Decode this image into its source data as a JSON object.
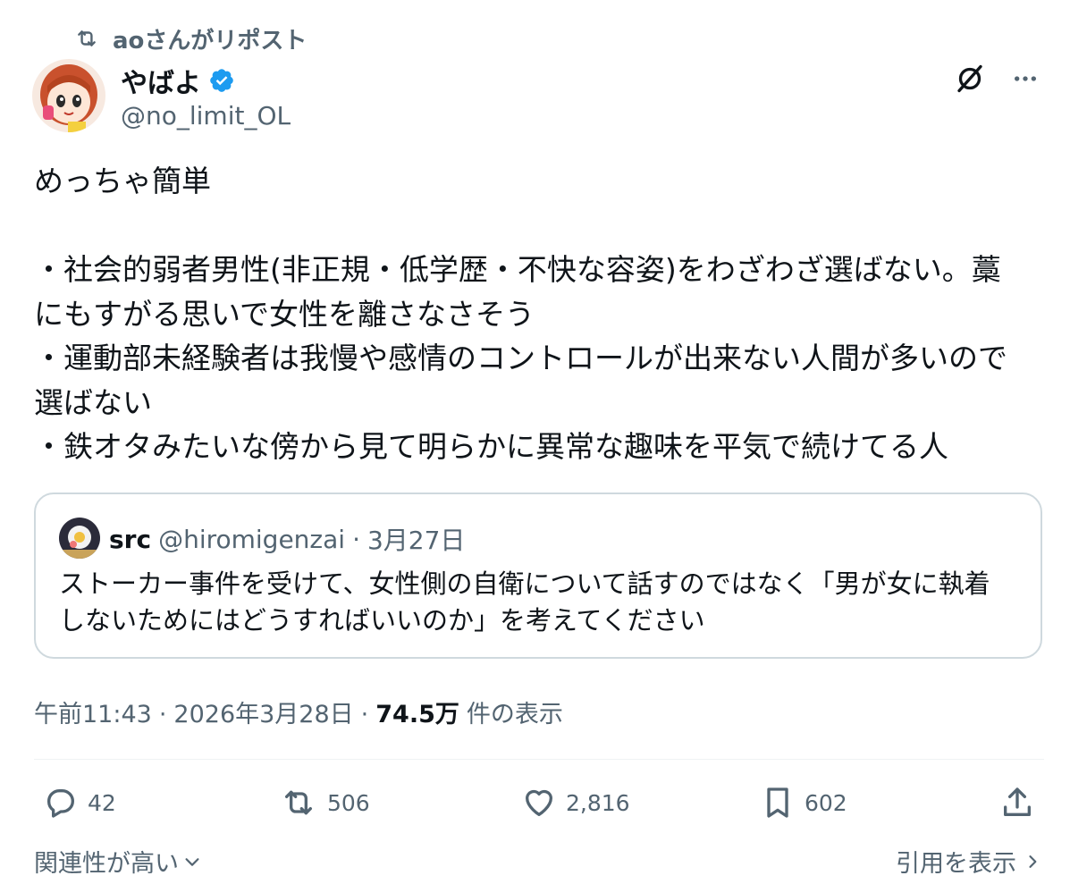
{
  "repost": {
    "label": "aoさんがリポスト"
  },
  "author": {
    "name": "やばよ",
    "handle": "@no_limit_OL"
  },
  "post": {
    "text": "めっちゃ簡単\n\n・社会的弱者男性(非正規・低学歴・不快な容姿)をわざわざ選ばない。藁\nにもすがる思いで女性を離さなさそう\n・運動部未経験者は我慢や感情のコントロールが出来ない人間が多いので\n選ばない\n・鉄オタみたいな傍から見て明らかに異常な趣味を平気で続けてる人"
  },
  "quote": {
    "name": "src",
    "handle": "@hiromigenzai",
    "separator": "·",
    "date": "3月27日",
    "text": "ストーカー事件を受けて、女性側の自衛について話すのではなく「男が女に執着\nしないためにはどうすればいいのか」を考えてください"
  },
  "meta": {
    "time": "午前11:43",
    "sep1": "·",
    "date": "2026年3月28日",
    "sep2": "·",
    "views": "74.5万",
    "views_label": "件の表示"
  },
  "actions": {
    "replies": "42",
    "reposts": "506",
    "likes": "2,816",
    "bookmarks": "602"
  },
  "footer": {
    "relevance": "関連性が高い",
    "quotes_link": "引用を表示"
  },
  "colors": {
    "text": "#0f1419",
    "secondary": "#536471",
    "verified": "#1d9bf0",
    "border": "#cfd9de"
  },
  "icons": [
    "repost-icon",
    "verified-badge-icon",
    "grok-icon",
    "more-icon",
    "reply-icon",
    "repost-icon",
    "like-icon",
    "bookmark-icon",
    "share-icon",
    "chevron-down-icon",
    "chevron-right-icon"
  ]
}
